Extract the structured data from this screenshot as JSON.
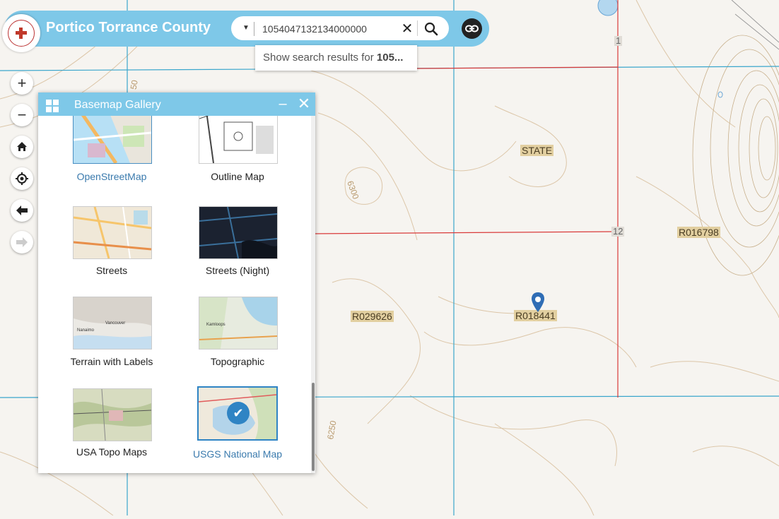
{
  "header": {
    "app_title": "Portico Torrance County",
    "logo_icon": "county-seal-logo"
  },
  "search": {
    "value": "1054047132134000000",
    "suggestion_prefix": "Show search results for ",
    "suggestion_term": "105..."
  },
  "nav": {
    "zoom_in": "+",
    "zoom_out": "−",
    "home_icon": "home-icon",
    "locate_icon": "locate-icon",
    "back_icon": "arrow-left-icon",
    "forward_icon": "arrow-right-icon"
  },
  "panel": {
    "title": "Basemap Gallery",
    "minimize": "–",
    "close": "✕",
    "items": [
      {
        "label": "OpenStreetMap",
        "selected": false
      },
      {
        "label": "Outline Map",
        "selected": false
      },
      {
        "label": "Streets",
        "selected": false
      },
      {
        "label": "Streets (Night)",
        "selected": false
      },
      {
        "label": "Terrain with Labels",
        "selected": false
      },
      {
        "label": "Topographic",
        "selected": false
      },
      {
        "label": "USA Topo Maps",
        "selected": false
      },
      {
        "label": "USGS National Map",
        "selected": true
      }
    ]
  },
  "map": {
    "labels": {
      "state": "STATE",
      "parcel_a": "R016798",
      "parcel_b": "R029626",
      "parcel_c": "R018441"
    },
    "sections": {
      "s1": "1",
      "s12": "12"
    },
    "contours": {
      "c6300": "6300",
      "c6250": "6250",
      "c50": "50"
    },
    "colors": {
      "parcel_line": "#d93a3a",
      "section_line": "#3aa6cc",
      "contour": "#d9c2a3",
      "accent": "#7ec8e8"
    }
  }
}
